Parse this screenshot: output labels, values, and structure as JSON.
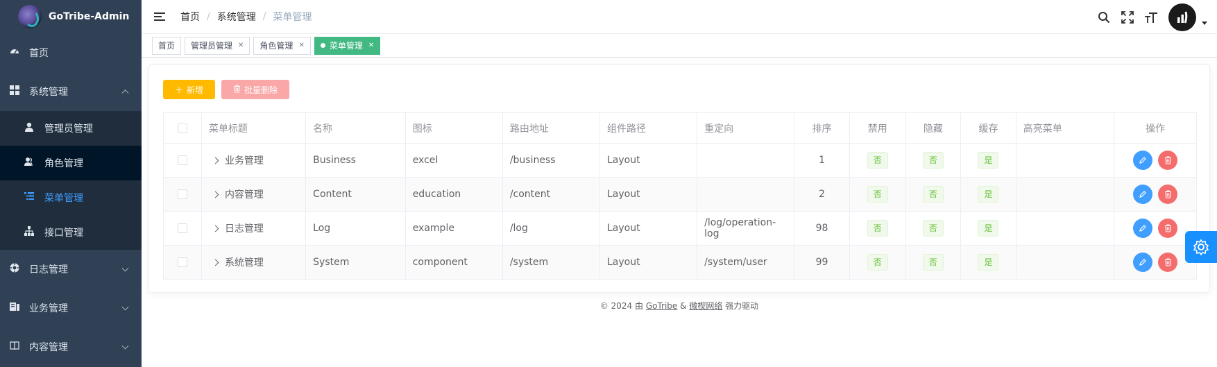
{
  "app": {
    "title": "GoTribe-Admin"
  },
  "sidebar": {
    "items": [
      {
        "label": "首页",
        "icon": "dashboard-icon"
      },
      {
        "label": "系统管理",
        "icon": "grid-icon",
        "expanded": true,
        "children": [
          {
            "label": "管理员管理",
            "icon": "user-icon"
          },
          {
            "label": "角色管理",
            "icon": "users-icon"
          },
          {
            "label": "菜单管理",
            "icon": "tree-table-icon",
            "active": true
          },
          {
            "label": "接口管理",
            "icon": "sitemap-icon"
          }
        ]
      },
      {
        "label": "日志管理",
        "icon": "log-icon"
      },
      {
        "label": "业务管理",
        "icon": "business-icon"
      },
      {
        "label": "内容管理",
        "icon": "book-icon"
      }
    ]
  },
  "header": {
    "breadcrumb": [
      "首页",
      "系统管理",
      "菜单管理"
    ],
    "sep": "/"
  },
  "tags": [
    {
      "label": "首页",
      "closable": false
    },
    {
      "label": "管理员管理",
      "closable": true
    },
    {
      "label": "角色管理",
      "closable": true
    },
    {
      "label": "菜单管理",
      "closable": true,
      "active": true
    }
  ],
  "toolbar": {
    "add_label": "新增",
    "batch_delete_label": "批量删除"
  },
  "table": {
    "columns": [
      "菜单标题",
      "名称",
      "图标",
      "路由地址",
      "组件路径",
      "重定向",
      "排序",
      "禁用",
      "隐藏",
      "缓存",
      "高亮菜单",
      "操作"
    ],
    "rows": [
      {
        "title": "业务管理",
        "name": "Business",
        "icon": "excel",
        "path": "/business",
        "component": "Layout",
        "redirect": "",
        "sort": "1",
        "disabled": "否",
        "hidden": "否",
        "cache": "是",
        "highlight": ""
      },
      {
        "title": "内容管理",
        "name": "Content",
        "icon": "education",
        "path": "/content",
        "component": "Layout",
        "redirect": "",
        "sort": "2",
        "disabled": "否",
        "hidden": "否",
        "cache": "是",
        "highlight": ""
      },
      {
        "title": "日志管理",
        "name": "Log",
        "icon": "example",
        "path": "/log",
        "component": "Layout",
        "redirect": "/log/operation-log",
        "sort": "98",
        "disabled": "否",
        "hidden": "否",
        "cache": "是",
        "highlight": ""
      },
      {
        "title": "系统管理",
        "name": "System",
        "icon": "component",
        "path": "/system",
        "component": "Layout",
        "redirect": "/system/user",
        "sort": "99",
        "disabled": "否",
        "hidden": "否",
        "cache": "是",
        "highlight": ""
      }
    ]
  },
  "footer": {
    "prefix": "© 2024 由",
    "link1": "GoTribe",
    "amp": "&",
    "link2": "微楔网络",
    "suffix": "强力驱动"
  },
  "colors": {
    "sidebar_bg": "#304156",
    "submenu_bg": "#1f2d3d",
    "accent": "#409eff",
    "active_tag": "#42b983",
    "add_button": "#ffba00",
    "delete_button": "#f9a7a7",
    "danger": "#f56c6c"
  }
}
